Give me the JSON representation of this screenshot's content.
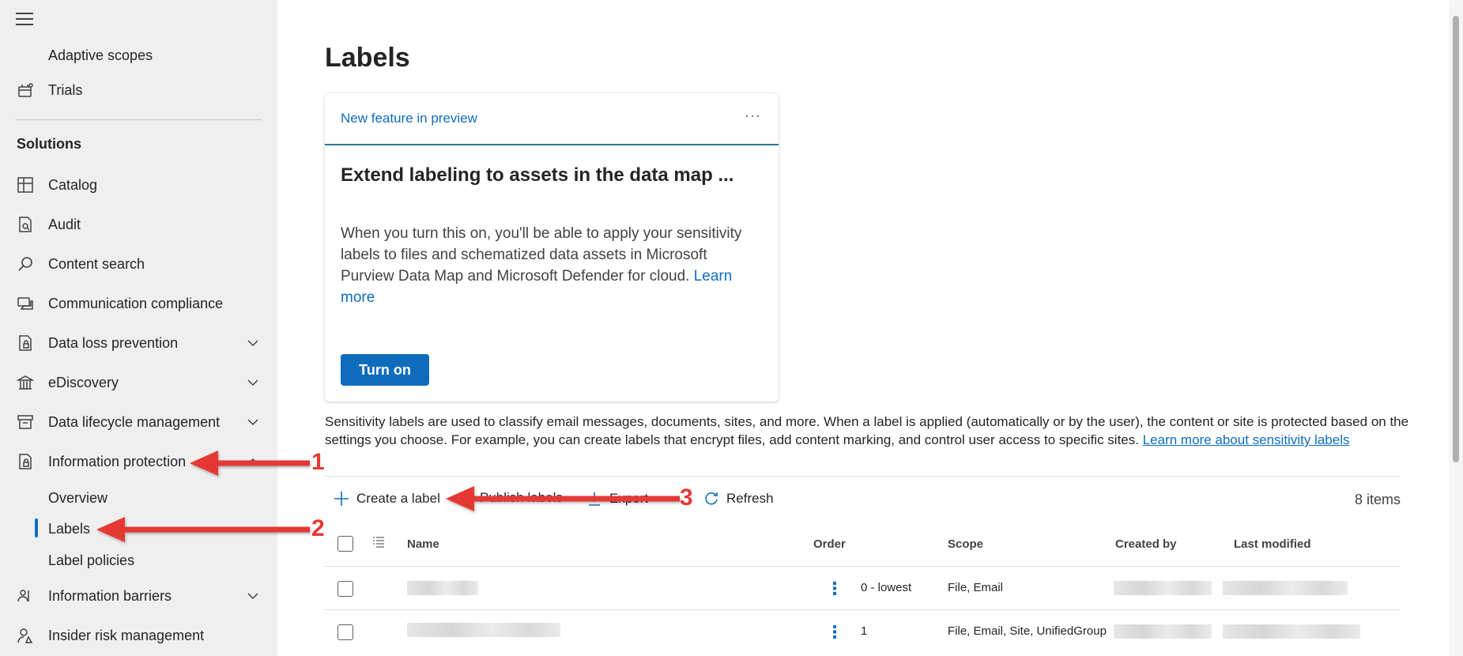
{
  "sidebar": {
    "items_top": [
      {
        "label": "Adaptive scopes",
        "icon": "adaptive-scopes-icon"
      },
      {
        "label": "Trials",
        "icon": "trials-icon"
      }
    ],
    "section_title": "Solutions",
    "items": [
      {
        "label": "Catalog",
        "icon": "catalog-icon"
      },
      {
        "label": "Audit",
        "icon": "audit-icon"
      },
      {
        "label": "Content search",
        "icon": "search-icon"
      },
      {
        "label": "Communication compliance",
        "icon": "communication-icon"
      },
      {
        "label": "Data loss prevention",
        "icon": "dlp-icon"
      },
      {
        "label": "eDiscovery",
        "icon": "ediscovery-icon"
      },
      {
        "label": "Data lifecycle management",
        "icon": "lifecycle-icon"
      },
      {
        "label": "Information protection",
        "icon": "info-protection-icon"
      },
      {
        "label": "Information barriers",
        "icon": "info-barriers-icon"
      },
      {
        "label": "Insider risk management",
        "icon": "insider-risk-icon"
      }
    ],
    "sub_items": [
      {
        "label": "Overview"
      },
      {
        "label": "Labels"
      },
      {
        "label": "Label policies"
      }
    ]
  },
  "main": {
    "title": "Labels",
    "card": {
      "tag": "New feature in preview",
      "more": "···",
      "title": "Extend labeling to assets in the data map ...",
      "body": "When you turn this on, you'll be able to apply your sensitivity labels to files and schematized data assets in Microsoft Purview Data Map and Microsoft Defender for cloud.",
      "link": "Learn more",
      "button": "Turn on"
    },
    "description": "Sensitivity labels are used to classify email messages, documents, sites, and more. When a label is applied (automatically or by the user), the content or site is protected based on the settings you choose. For example, you can create labels that encrypt files, add content marking, and control user access to specific sites.",
    "description_link": "Learn more about sensitivity labels",
    "toolbar": {
      "create": "Create a label",
      "publish": "Publish labels",
      "export": "Export",
      "refresh": "Refresh",
      "count": "8 items"
    },
    "table": {
      "columns": [
        "Name",
        "Order",
        "Scope",
        "Created by",
        "Last modified"
      ],
      "rows": [
        {
          "order": "0 - lowest",
          "scope": "File, Email"
        },
        {
          "order": "1",
          "scope": "File, Email, Site, UnifiedGroup"
        }
      ]
    }
  },
  "annotations": [
    "1",
    "2",
    "3"
  ],
  "colors": {
    "accent": "#0f6cbd",
    "arrow": "#e53935",
    "sidebar_bg": "#efefef"
  }
}
